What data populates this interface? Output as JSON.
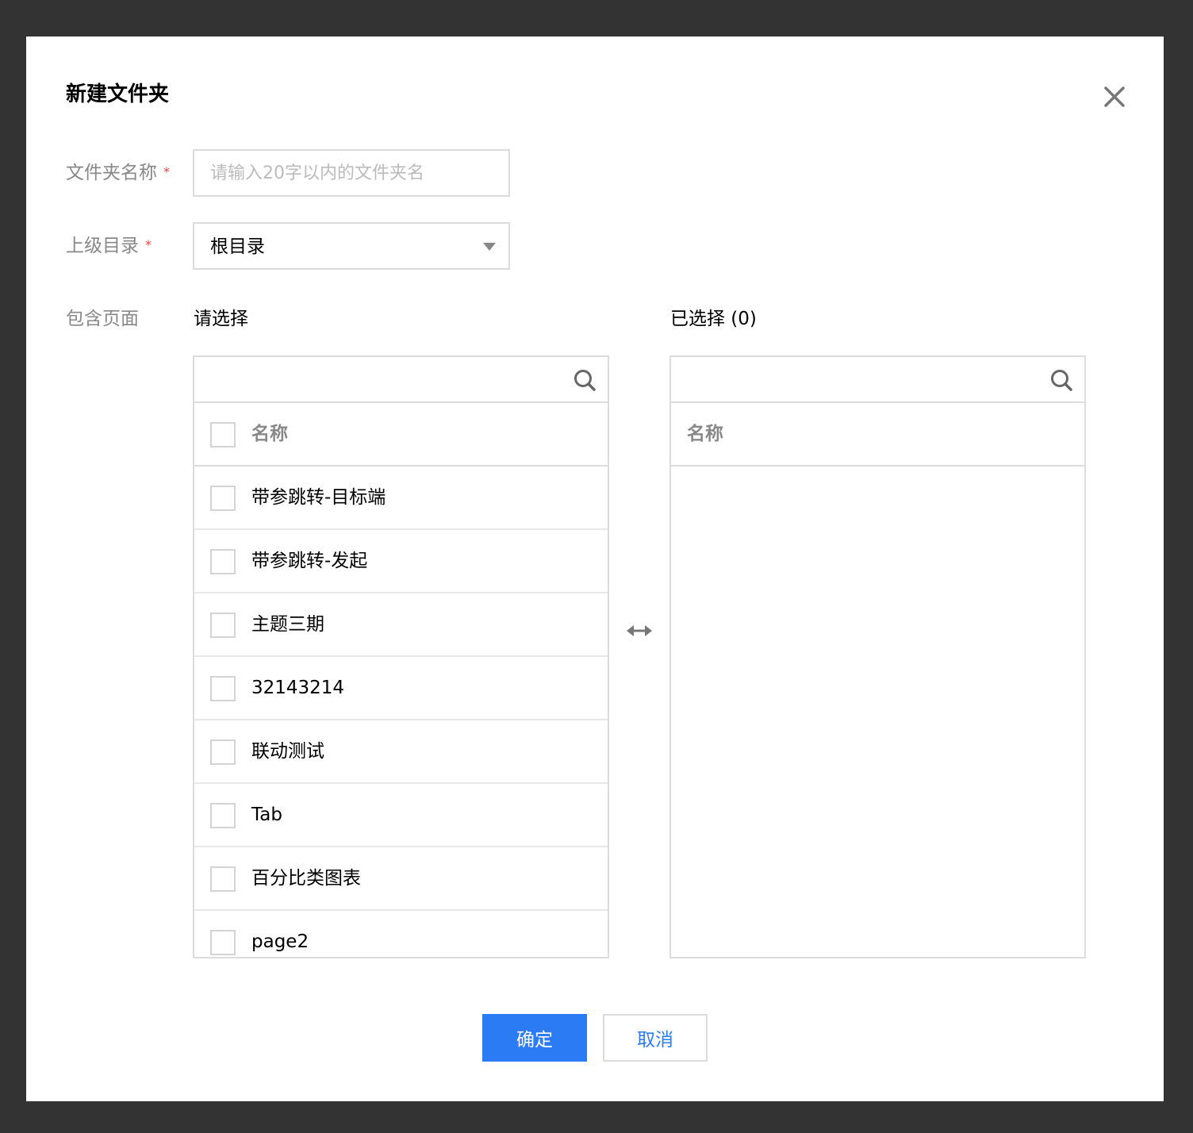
{
  "dialog": {
    "title": "新建文件夹",
    "close_icon": "close-icon"
  },
  "form": {
    "folder_name": {
      "label": "文件夹名称",
      "required_mark": "*",
      "value": "",
      "placeholder": "请输入20字以内的文件夹名"
    },
    "parent_dir": {
      "label": "上级目录",
      "required_mark": "*",
      "selected": "根目录"
    },
    "pages": {
      "label": "包含页面"
    }
  },
  "transfer": {
    "left": {
      "title": "请选择",
      "search_placeholder": "",
      "column_header": "名称",
      "items": [
        "带参跳转-目标端",
        "带参跳转-发起",
        "主题三期",
        "32143214",
        "联动测试",
        "Tab",
        "百分比类图表",
        "page2"
      ]
    },
    "right": {
      "title": "已选择 (0)",
      "search_placeholder": "",
      "column_header": "名称",
      "items": []
    },
    "transfer_icon": "swap-horizontal-icon"
  },
  "actions": {
    "confirm_label": "确定",
    "cancel_label": "取消"
  },
  "colors": {
    "primary": "#2b7bf5",
    "required": "#e54545",
    "backdrop": "#333333"
  }
}
